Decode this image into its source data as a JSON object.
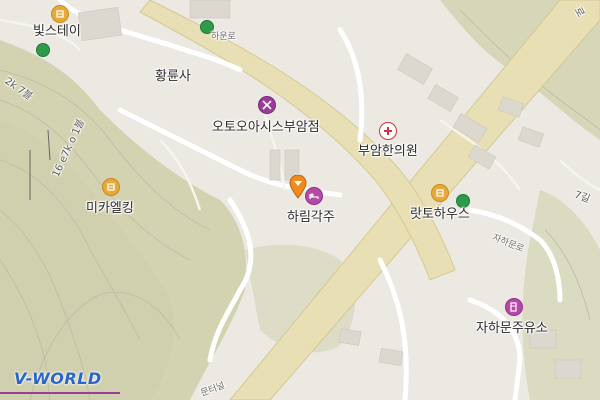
{
  "map": {
    "labels": {
      "bitsteu": "빛스테이",
      "hwangryunsa": "황륜사",
      "autooasis": "오토오아시스부암점",
      "buamhanuiwon": "부암한의원",
      "mikaelking": "미카엘킹",
      "harimgakju": "하림각주",
      "latohouse": "랏토하우스",
      "jahamunjuyuso": "자하문주유소",
      "jahamunro": "자하문로",
      "harunro": "하운로",
      "tunnel": "문터널",
      "road7gil": "7길",
      "side_left_1": "2k 7블",
      "side_left_2": "16 e7k o 1블",
      "corner_top_right": "로"
    },
    "logo_text": "V-WORLD",
    "colors": {
      "land": "#ece9e3",
      "green": "#d4d4b4",
      "road_main": "#e9dfb6",
      "road_minor": "#ffffff",
      "bus_stop": "#2e9b4a",
      "marker": "#f08a1c"
    }
  }
}
